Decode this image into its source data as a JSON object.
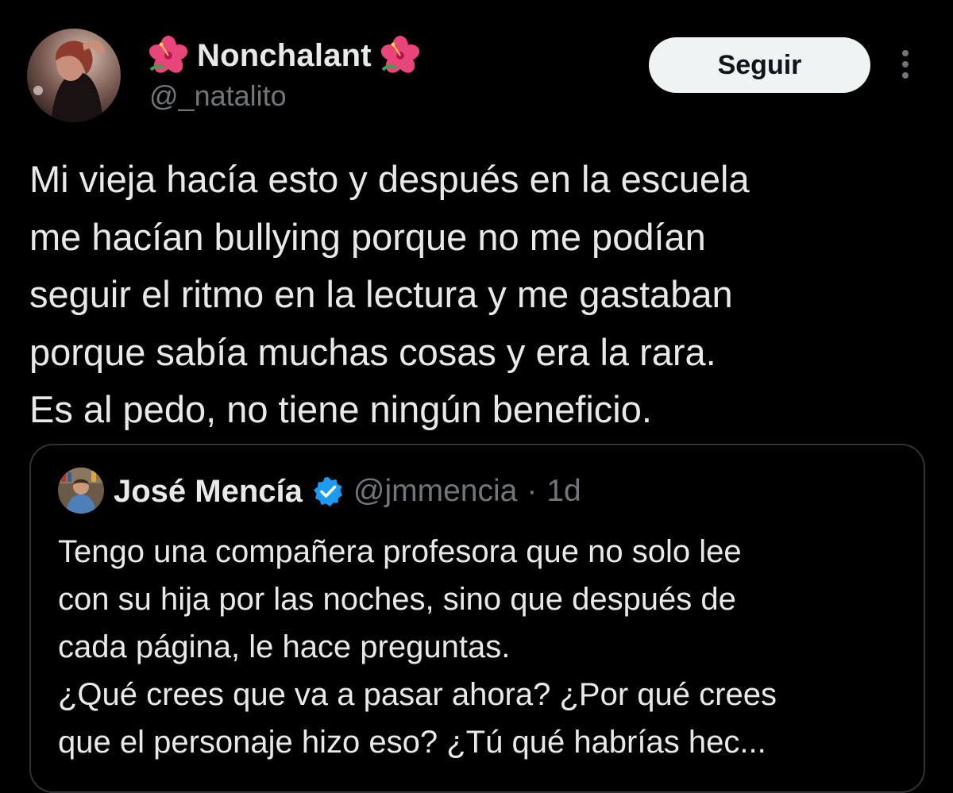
{
  "colors": {
    "background": "#000000",
    "text_primary": "#e7e9ea",
    "text_secondary": "#71767b",
    "border": "#2f3336",
    "follow_bg": "#eff3f4",
    "verified_blue": "#1d9bf0",
    "flower": "#e8457a"
  },
  "tweet": {
    "author": {
      "display_name": "Nonchalant",
      "handle": "@_natalito",
      "name_emoji_icon": "hibiscus-flower-icon",
      "avatar_icon": "user-avatar"
    },
    "follow_label": "Seguir",
    "more_icon": "more-vertical-icon",
    "text": "Mi vieja hacía esto y después en la escuela\nme hacían bullying porque no me podían\nseguir el ritmo en la lectura y me gastaban\nporque sabía muchas cosas y era la rara.\nEs al pedo, no tiene ningún beneficio."
  },
  "quote": {
    "author": {
      "display_name": "José Mencía",
      "handle": "@jmmencia",
      "verified_icon": "verified-badge-icon",
      "avatar_icon": "user-avatar"
    },
    "separator": "·",
    "time": "1d",
    "text": "Tengo una compañera profesora que no solo lee\ncon su hija por las noches, sino que después de\ncada página, le hace preguntas.\n¿Qué crees que va a pasar ahora? ¿Por qué crees\nque el personaje hizo eso? ¿Tú qué habrías hec..."
  }
}
